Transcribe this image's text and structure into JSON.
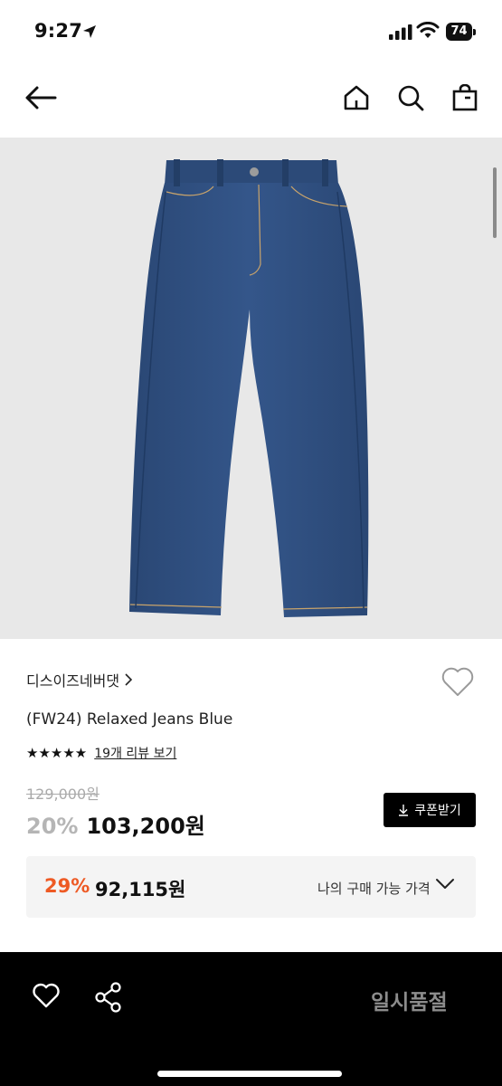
{
  "status": {
    "time": "9:27",
    "battery": "74"
  },
  "product": {
    "brand": "디스이즈네버댓",
    "title": "(FW24) Relaxed Jeans Blue",
    "rating_stars": "★★★★★",
    "review_link": "19개 리뷰 보기",
    "original_price": "129,000원",
    "discount": "20%",
    "price": "103,200원",
    "coupon_label": "쿠폰받기"
  },
  "my_price": {
    "rate": "29%",
    "price": "92,115원",
    "label": "나의 구매 가능 가격"
  },
  "bottom": {
    "soldout_label": "일시품절"
  },
  "icons": [
    "back-arrow-icon",
    "home-icon",
    "search-icon",
    "shopping-bag-icon",
    "heart-icon",
    "share-icon",
    "download-icon",
    "chevron-down-icon"
  ],
  "colors": {
    "accent": "#ee5a24",
    "bar": "#000000",
    "hero_bg": "#e8e8e8",
    "denim": "#2f4f7e"
  }
}
